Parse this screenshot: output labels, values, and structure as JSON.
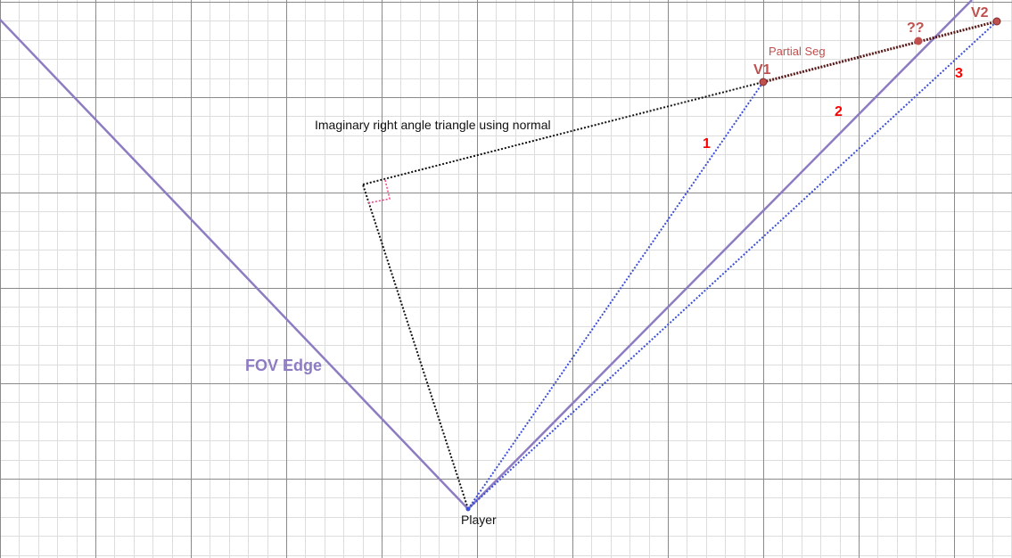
{
  "labels": {
    "imaginary_triangle": "Imaginary right angle triangle using normal",
    "fov_edge": "FOV Edge",
    "partial_seg": "Partial Seg",
    "v1": "V1",
    "v2": "V2",
    "intersection": "??",
    "player": "Player",
    "ray_1": "1",
    "ray_2": "2",
    "ray_3": "3"
  },
  "colors": {
    "fov_edge": "#8e7cc3",
    "rays": "#3c4fd6",
    "triangle": "#111111",
    "right_angle_marker": "#ff3b7a",
    "segment_points": "#c0504d",
    "ray_numbers": "#ff0000",
    "grid_major": "#8a8a8a",
    "grid_minor": "#dddddd"
  }
}
